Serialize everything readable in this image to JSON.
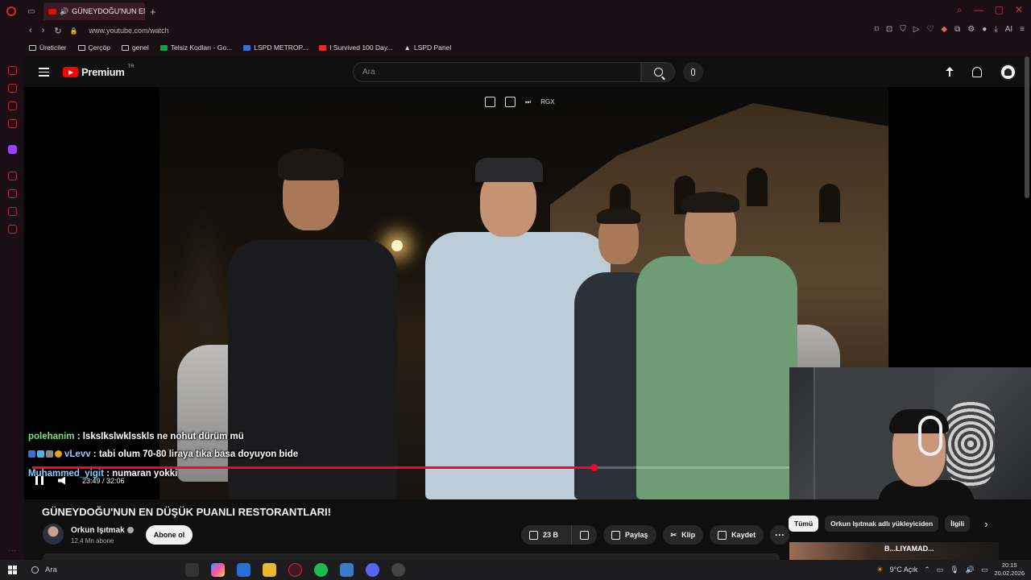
{
  "browser": {
    "tab_title": "GÜNEYDOĞU'NUN EN",
    "url": "www.youtube.com/watch",
    "bookmarks": [
      "Üreticiler",
      "Çerçöp",
      "genel",
      "Telsiz Kodları - Go...",
      "LSPD METROP...",
      "I Survived 100 Day...",
      "LSPD Panel"
    ],
    "extensions_label": "AI"
  },
  "youtube": {
    "brand": "Premium",
    "region": "TR",
    "search_placeholder": "Ara"
  },
  "video": {
    "overlay_label": "RGX",
    "time_current": "23:49",
    "time_total": "32:06",
    "time_display": "23:49 / 32:06",
    "progress_fraction": 0.742,
    "chat": [
      {
        "user": "polehanim",
        "message": " : lsksIkslwklsskls ne nohut dürüm mü"
      },
      {
        "user": "vLevv",
        "message": " : tabi olum 70-80 liraya tıka basa doyuyon bide"
      },
      {
        "user": "Muhammed_yigit",
        "message": " : numaran yokki"
      }
    ]
  },
  "details": {
    "title": "GÜNEYDOĞU'NUN EN DÜŞÜK PUANLI RESTORANTLARI!",
    "channel": "Orkun Işıtmak",
    "subscribers": "12,4 Mn abone",
    "subscribe_label": "Abone ol",
    "likes": "23 B",
    "share_label": "Paylaş",
    "clip_label": "Klip",
    "save_label": "Kaydet",
    "more_label": "···"
  },
  "recommendations": {
    "chips": [
      "Tümü",
      "Orkun Işıtmak adlı yükleyiciden",
      "İlgili"
    ],
    "thumb_text": "B...LIYAMAD..."
  },
  "taskbar": {
    "search_label": "Ara",
    "weather": "9°C  Açık",
    "time": "20:15",
    "date": "20.02.2026"
  },
  "colors": {
    "accent": "#ff0033",
    "youtube_red": "#ff0000",
    "opera_red": "#e0203a"
  }
}
